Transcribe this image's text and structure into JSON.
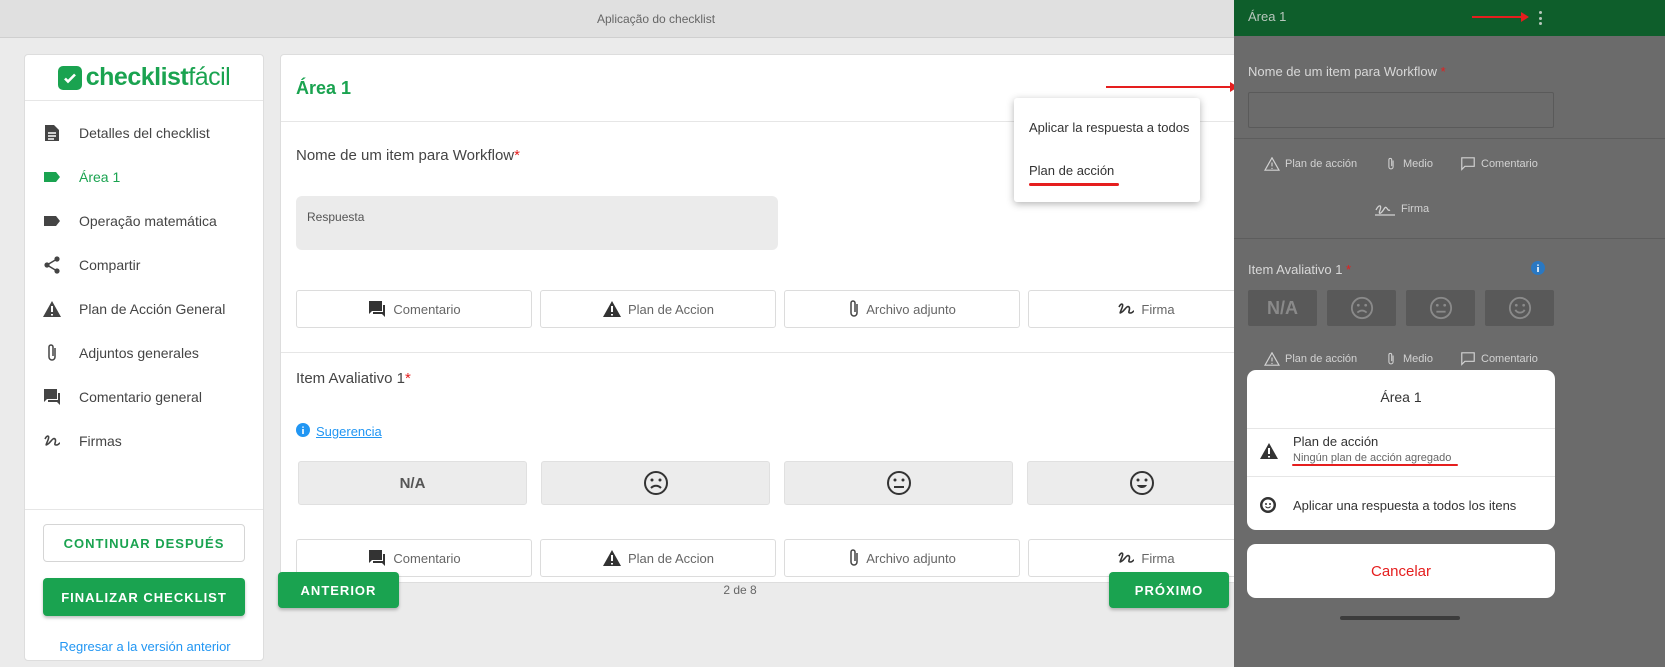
{
  "window": {
    "title": "Aplicação do checklist"
  },
  "brand": {
    "logo_bold": "checklist",
    "logo_light": "fácil"
  },
  "sidebar": {
    "items": [
      {
        "label": "Detalles del checklist",
        "icon": "document-icon"
      },
      {
        "label": "Área 1",
        "icon": "label-tag-icon",
        "active": true
      },
      {
        "label": "Operação matemática",
        "icon": "label-tag-icon"
      },
      {
        "label": "Compartir",
        "icon": "share-icon"
      },
      {
        "label": "Plan de Acción General",
        "icon": "warning-icon"
      },
      {
        "label": "Adjuntos generales",
        "icon": "paperclip-icon"
      },
      {
        "label": "Comentario general",
        "icon": "comment-icon"
      },
      {
        "label": "Firmas",
        "icon": "signature-icon"
      }
    ],
    "continue_label": "CONTINUAR DESPUÉS",
    "finish_label": "FINALIZAR CHECKLIST",
    "prev_version_link": "Regresar a la versión anterior"
  },
  "main": {
    "area_title": "Área 1",
    "item1": {
      "title": "Nome de um item para Workflow",
      "required_mark": "*",
      "placeholder": "Respuesta"
    },
    "actions": {
      "comment": "Comentario",
      "plan": "Plan de Accion",
      "attach": "Archivo adjunto",
      "sign": "Firma"
    },
    "item2": {
      "title": "Item Avaliativo 1",
      "required_mark": "*",
      "suggestion": "Sugerencia"
    },
    "ratings": {
      "na": "N/A",
      "sad": "sad-face-icon",
      "neutral": "neutral-face-icon",
      "happy": "happy-face-icon"
    },
    "menu": {
      "apply_all": "Aplicar la respuesta a todos",
      "action_plan": "Plan de acción"
    }
  },
  "nav": {
    "prev": "ANTERIOR",
    "page": "2 de 8",
    "next": "PRÓXIMO"
  },
  "phone": {
    "header_title": "Área 1",
    "item1": {
      "title": "Nome de um item para Workflow",
      "required_mark": "*"
    },
    "actions": {
      "plan": "Plan de acción",
      "media": "Medio",
      "comment": "Comentario",
      "sign": "Firma"
    },
    "item2": {
      "title": "Item Avaliativo 1",
      "required_mark": "*"
    },
    "rating_na": "N/A",
    "sheet": {
      "title": "Área 1",
      "plan_title": "Plan de acción",
      "plan_sub": "Ningún plan de acción agregado",
      "apply_all": "Aplicar una respuesta a todos los itens"
    },
    "cancel": "Cancelar"
  },
  "colors": {
    "accent": "#1aa350",
    "annotation": "#e51e1e",
    "link": "#2196f3"
  }
}
